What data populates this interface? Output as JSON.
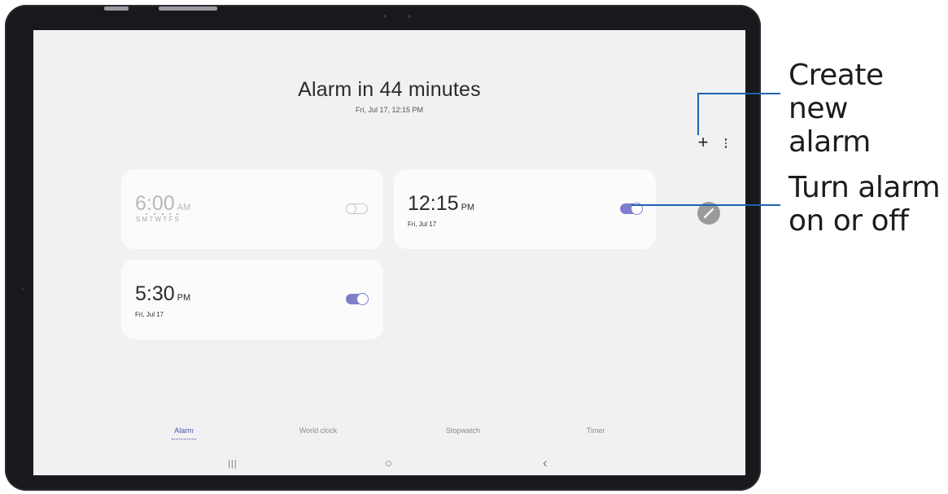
{
  "header": {
    "title": "Alarm in 44 minutes",
    "subtitle": "Fri, Jul 17, 12:15 PM"
  },
  "toolbar": {
    "add_icon": "plus-icon",
    "more_icon": "more-vertical-icon"
  },
  "alarms": [
    {
      "time": "6:00",
      "ampm": "AM",
      "repeat_days": "SMTWTFS",
      "enabled": false
    },
    {
      "time": "12:15",
      "ampm": "PM",
      "date": "Fri, Jul 17",
      "enabled": true
    },
    {
      "time": "5:30",
      "ampm": "PM",
      "date": "Fri, Jul 17",
      "enabled": true
    }
  ],
  "edit_icon": "pencil-icon",
  "tabs": [
    {
      "label": "Alarm",
      "active": true
    },
    {
      "label": "World clock",
      "active": false
    },
    {
      "label": "Stopwatch",
      "active": false
    },
    {
      "label": "Timer",
      "active": false
    }
  ],
  "nav_bar": {
    "recents_glyph": "|||",
    "home_glyph": "○",
    "back_glyph": "‹"
  },
  "callouts": {
    "create": "Create new alarm",
    "create_line1": "Create new",
    "create_line2": "alarm",
    "toggle": "Turn alarm on or off",
    "toggle_line1": "Turn alarm",
    "toggle_line2": "on or off"
  },
  "colors": {
    "accent": "#7d7fcb",
    "active_tab": "#4e4fa8",
    "callout_line": "#1e63b0"
  }
}
